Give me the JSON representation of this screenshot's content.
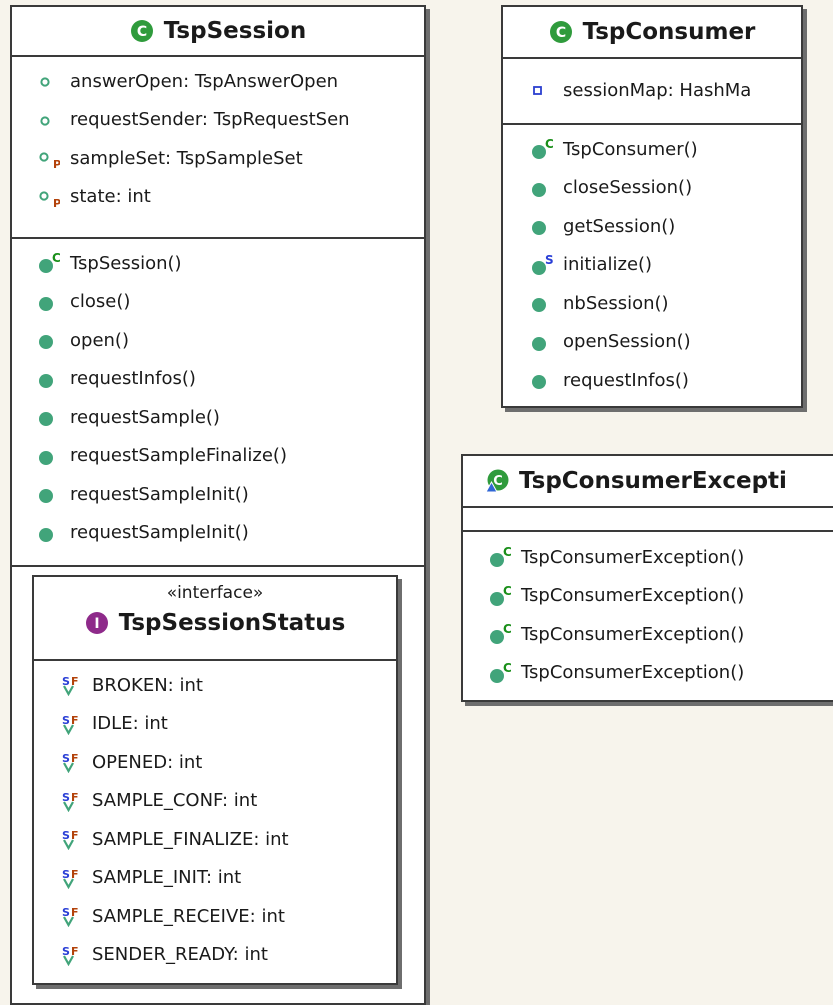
{
  "colors": {
    "background": "#f7f4ec",
    "border": "#3a3a3a",
    "method": "#41a47a",
    "class_badge": "#2f9b3c",
    "interface_badge": "#8e2a8a",
    "constructor_mark": "#1a8f1a",
    "static_mark": "#2a3fd6",
    "final_mark": "#b3420a",
    "private_field": "#2b3fd0"
  },
  "session": {
    "title": "TspSession",
    "badge": "C",
    "fields": [
      {
        "text": "answerOpen: TspAnswerOpen",
        "icon": "field-default-icon"
      },
      {
        "text": "requestSender: TspRequestSen",
        "icon": "field-default-icon"
      },
      {
        "text": "sampleSet: TspSampleSet",
        "icon": "field-protected-icon",
        "mark": "P"
      },
      {
        "text": "state: int",
        "icon": "field-protected-icon",
        "mark": "P"
      }
    ],
    "methods": [
      {
        "text": "TspSession()",
        "icon": "constructor-icon",
        "mark": "C"
      },
      {
        "text": "close()",
        "icon": "public-method-icon"
      },
      {
        "text": "open()",
        "icon": "public-method-icon"
      },
      {
        "text": "requestInfos()",
        "icon": "public-method-icon"
      },
      {
        "text": "requestSample()",
        "icon": "public-method-icon"
      },
      {
        "text": "requestSampleFinalize()",
        "icon": "public-method-icon"
      },
      {
        "text": "requestSampleInit()",
        "icon": "public-method-icon"
      },
      {
        "text": "requestSampleInit()",
        "icon": "public-method-icon"
      }
    ]
  },
  "status": {
    "stereotype": "«interface»",
    "title": "TspSessionStatus",
    "badge": "I",
    "mark_s": "S",
    "mark_f": "F",
    "fields": [
      "BROKEN: int",
      "IDLE: int",
      "OPENED: int",
      "SAMPLE_CONF: int",
      "SAMPLE_FINALIZE: int",
      "SAMPLE_INIT: int",
      "SAMPLE_RECEIVE: int",
      "SENDER_READY: int"
    ]
  },
  "consumer": {
    "title": "TspConsumer",
    "badge": "C",
    "fields": [
      {
        "text": "sessionMap: HashMa",
        "icon": "private-field-icon"
      }
    ],
    "methods": [
      {
        "text": "TspConsumer()",
        "icon": "constructor-icon",
        "mark": "C"
      },
      {
        "text": "closeSession()",
        "icon": "public-method-icon"
      },
      {
        "text": "getSession()",
        "icon": "public-method-icon"
      },
      {
        "text": "initialize()",
        "icon": "static-method-icon",
        "mark": "S"
      },
      {
        "text": "nbSession()",
        "icon": "public-method-icon"
      },
      {
        "text": "openSession()",
        "icon": "public-method-icon"
      },
      {
        "text": "requestInfos()",
        "icon": "public-method-icon"
      }
    ]
  },
  "exception": {
    "title": "TspConsumerExcepti",
    "badge": "C",
    "methods": [
      {
        "text": "TspConsumerException()",
        "icon": "constructor-icon",
        "mark": "C"
      },
      {
        "text": "TspConsumerException()",
        "icon": "constructor-icon",
        "mark": "C"
      },
      {
        "text": "TspConsumerException()",
        "icon": "constructor-icon",
        "mark": "C"
      },
      {
        "text": "TspConsumerException()",
        "icon": "constructor-icon",
        "mark": "C"
      }
    ]
  }
}
